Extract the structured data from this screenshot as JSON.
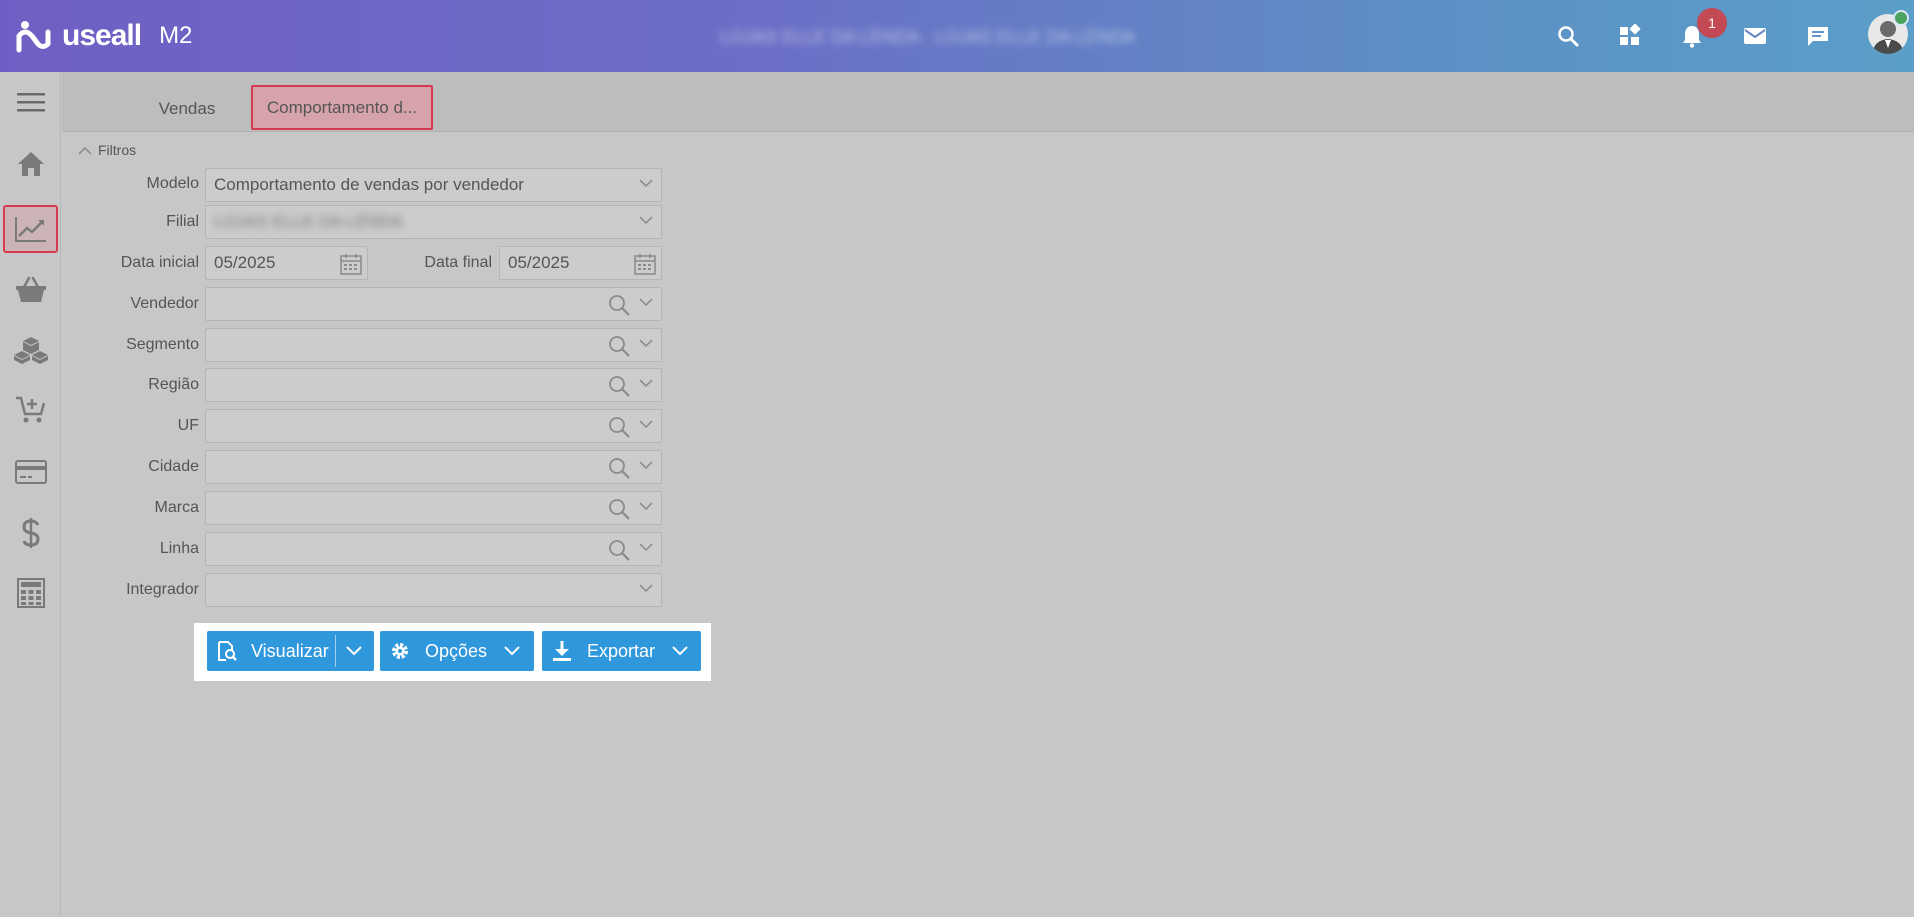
{
  "header": {
    "brand": "useall",
    "brand_suffix": "M2",
    "company": "LOJAS ELLE DA LÉNDA · LOJAS ELLE DA LÉNDA",
    "notifications_count": "1"
  },
  "tabs": [
    {
      "label": "Vendas"
    },
    {
      "label": "Comportamento d..."
    }
  ],
  "filters": {
    "toggle_label": "Filtros",
    "modelo": {
      "label": "Modelo",
      "value": "Comportamento de vendas por vendedor"
    },
    "filial": {
      "label": "Filial",
      "value": "LOJAS ELLE DA LÉNDA"
    },
    "data_inicial": {
      "label": "Data inicial",
      "value": "05/2025"
    },
    "data_final": {
      "label": "Data final",
      "value": "05/2025"
    },
    "vendedor": {
      "label": "Vendedor"
    },
    "segmento": {
      "label": "Segmento"
    },
    "regiao": {
      "label": "Região"
    },
    "uf": {
      "label": "UF"
    },
    "cidade": {
      "label": "Cidade"
    },
    "marca": {
      "label": "Marca"
    },
    "linha": {
      "label": "Linha"
    },
    "integrador": {
      "label": "Integrador"
    }
  },
  "actions": {
    "visualizar": "Visualizar",
    "opcoes": "Opções",
    "exportar": "Exportar"
  },
  "colors": {
    "accent_button": "#2f97dc",
    "highlight_border": "#d53b4e",
    "badge": "#c34a55"
  }
}
